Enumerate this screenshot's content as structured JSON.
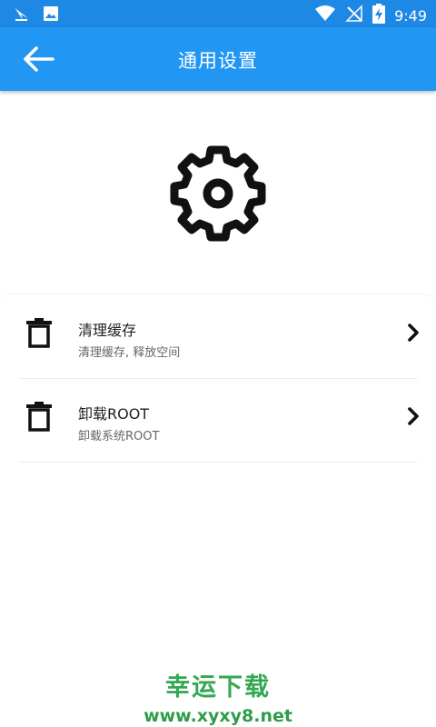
{
  "status_bar": {
    "time": "9:49",
    "left_icons": [
      "notification-app-icon",
      "image-icon"
    ],
    "right_icons": [
      "wifi-icon",
      "no-signal-icon",
      "battery-charging-icon"
    ]
  },
  "app_bar": {
    "title": "通用设置",
    "back_icon": "arrow-left-icon",
    "color": "#2196f3"
  },
  "header_icon": "gear-icon",
  "settings": [
    {
      "title": "清理缓存",
      "subtitle": "清理缓存, 释放空间",
      "icon": "trash-icon"
    },
    {
      "title": "卸载ROOT",
      "subtitle": "卸载系统ROOT",
      "icon": "trash-icon"
    }
  ],
  "watermark": {
    "text": "幸运下载",
    "url": "www.xyxy8.net",
    "color": "#33a853"
  }
}
